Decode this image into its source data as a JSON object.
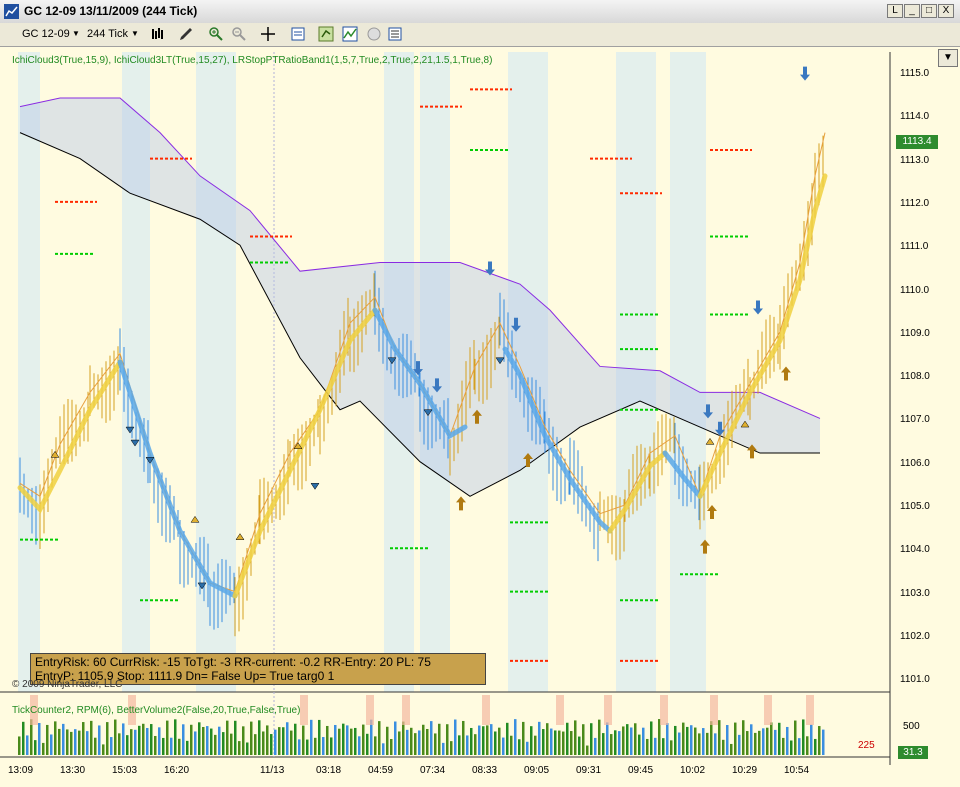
{
  "window": {
    "title": "GC 12-09  13/11/2009 (244 Tick)",
    "min": "_",
    "max": "□",
    "close": "X",
    "restore": "L"
  },
  "toolbar": {
    "instrument": "GC 12-09",
    "period": "244 Tick"
  },
  "indicator_label": "IchiCloud3(True,15,9), IchiCloud3LT(True,15,27), LRStopPTRatioBand1(1,5,7,True,2,True,2,21,1.5,1,True,8)",
  "copyright": "© 2009 NinjaTrader, LLC",
  "volume_label": "TickCounter2, RPM(6), BetterVolume2(False,20,True,False,True)",
  "info_box": {
    "line1": "EntryRisk: 60 CurrRisk: -15 ToTgt: -3 RR-current: -0.2 RR-Entry: 20 PL: 75",
    "line2": "EntryP: 1105.9 Stop: 1111.9 Dn= False Up= True targ0 1"
  },
  "price_axis": [
    "1115.0",
    "1114.0",
    "1113.0",
    "1112.0",
    "1111.0",
    "1110.0",
    "1109.0",
    "1108.0",
    "1107.0",
    "1106.0",
    "1105.0",
    "1104.0",
    "1103.0",
    "1102.0",
    "1101.0"
  ],
  "last_price": "1113.4",
  "time_axis": [
    "13:09",
    "13:30",
    "15:03",
    "16:20",
    "11/13",
    "03:18",
    "04:59",
    "07:34",
    "08:33",
    "09:05",
    "09:31",
    "09:45",
    "10:02",
    "10:29",
    "10:54"
  ],
  "volume_axis": "500",
  "volume_last": "31.3",
  "tick_count": "225",
  "colors": {
    "up_bar": "#d4a020",
    "down_bar": "#3a8ee0",
    "cloud_fill": "#b8c8e8",
    "kijun": "#8a2be2",
    "background": "#fffbe0",
    "stop_red": "#ff2a00",
    "target_green": "#00cc00"
  }
}
